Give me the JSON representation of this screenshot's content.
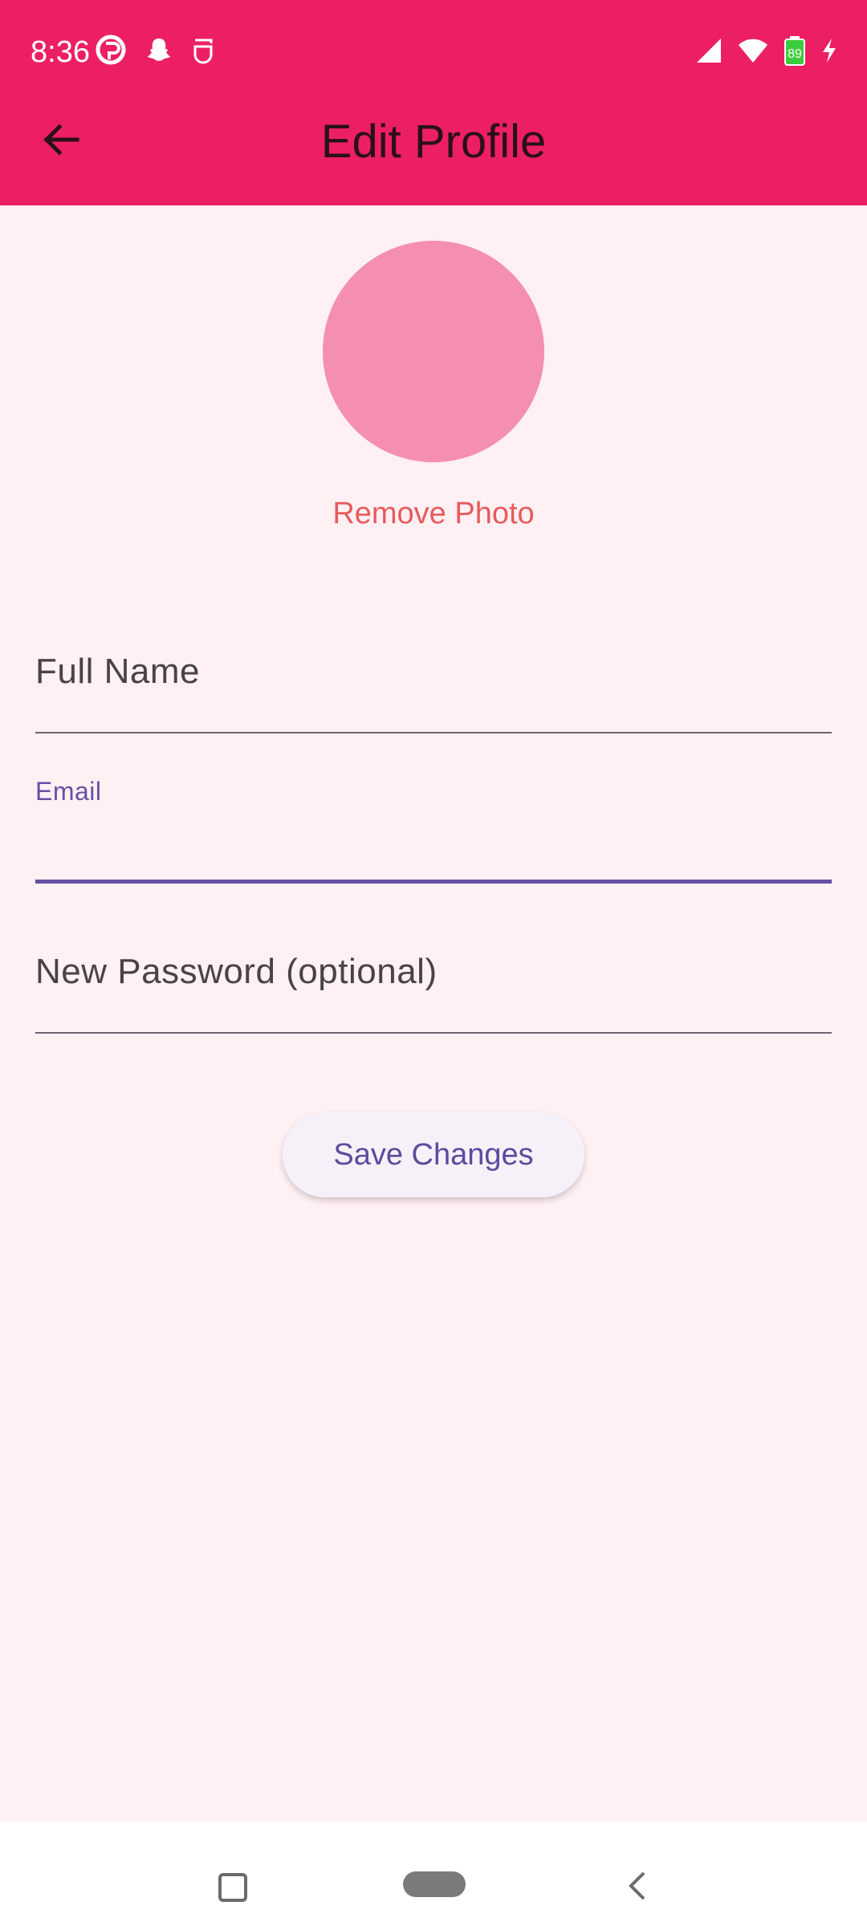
{
  "status_bar": {
    "time": "8:36",
    "left_icons": [
      "sync-icon",
      "snapchat-icon",
      "app-icon"
    ],
    "battery_level": "89",
    "right_icons": [
      "signal-icon",
      "wifi-icon",
      "battery-icon",
      "charging-icon"
    ]
  },
  "app_bar": {
    "title": "Edit Profile",
    "back_icon": "arrow-back-icon",
    "color": "#EC1F65"
  },
  "profile": {
    "avatar_color": "#F48FB1",
    "remove_photo_label": "Remove Photo",
    "remove_photo_color": "#E75B5B"
  },
  "form": {
    "full_name": {
      "label": "Full Name",
      "value": ""
    },
    "email": {
      "label": "Email",
      "value": "",
      "focused": true
    },
    "password": {
      "label": "New Password (optional)",
      "value": ""
    },
    "accent_color": "#6750A4"
  },
  "actions": {
    "save_label": "Save Changes"
  },
  "navigation_bar": {
    "buttons": [
      "recents-button",
      "home-button",
      "back-button"
    ]
  },
  "colors": {
    "background": "#FFF0F4"
  }
}
